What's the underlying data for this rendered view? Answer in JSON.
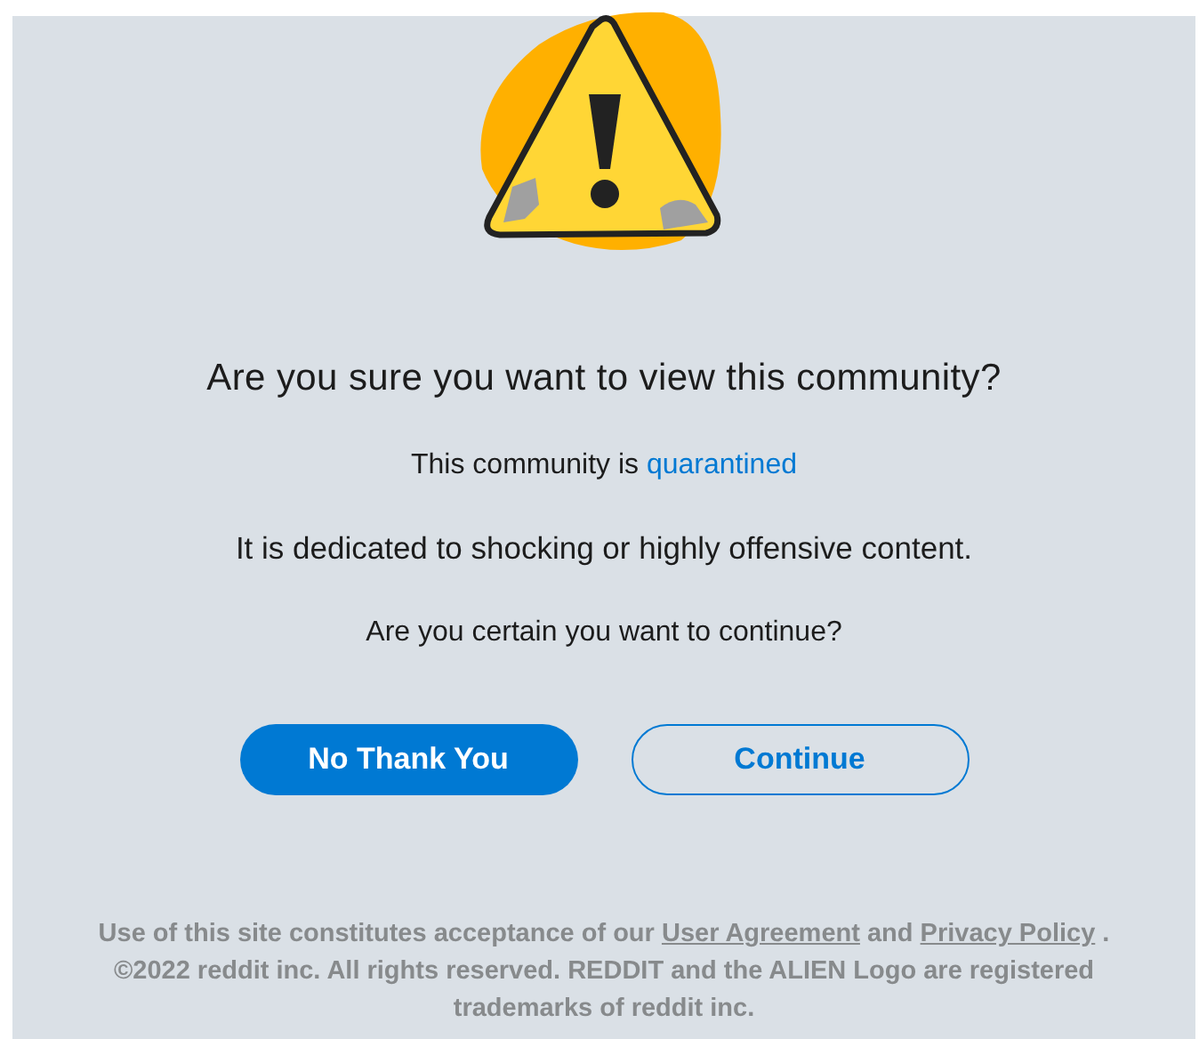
{
  "dialog": {
    "title": "Are you sure you want to view this community?",
    "status_line": {
      "prefix": "This community is",
      "link": "quarantined"
    },
    "description": "It is dedicated to shocking or highly offensive content.",
    "question": "Are you certain you want to continue?",
    "buttons": [
      {
        "label": "No Thank You",
        "kind": "primary"
      },
      {
        "label": "Continue",
        "kind": "outline"
      }
    ]
  },
  "footer": {
    "segments": [
      {
        "text": "Use of this site constitutes acceptance of our",
        "kind": "text"
      },
      {
        "text": "User Agreement",
        "kind": "link"
      },
      {
        "text": "and",
        "kind": "text"
      },
      {
        "text": "Privacy Policy",
        "kind": "link"
      },
      {
        "text": ".",
        "kind": "text"
      }
    ],
    "copyright": "©2022 reddit inc. All rights reserved. REDDIT and the ALIEN Logo are registered trademarks of reddit inc."
  }
}
